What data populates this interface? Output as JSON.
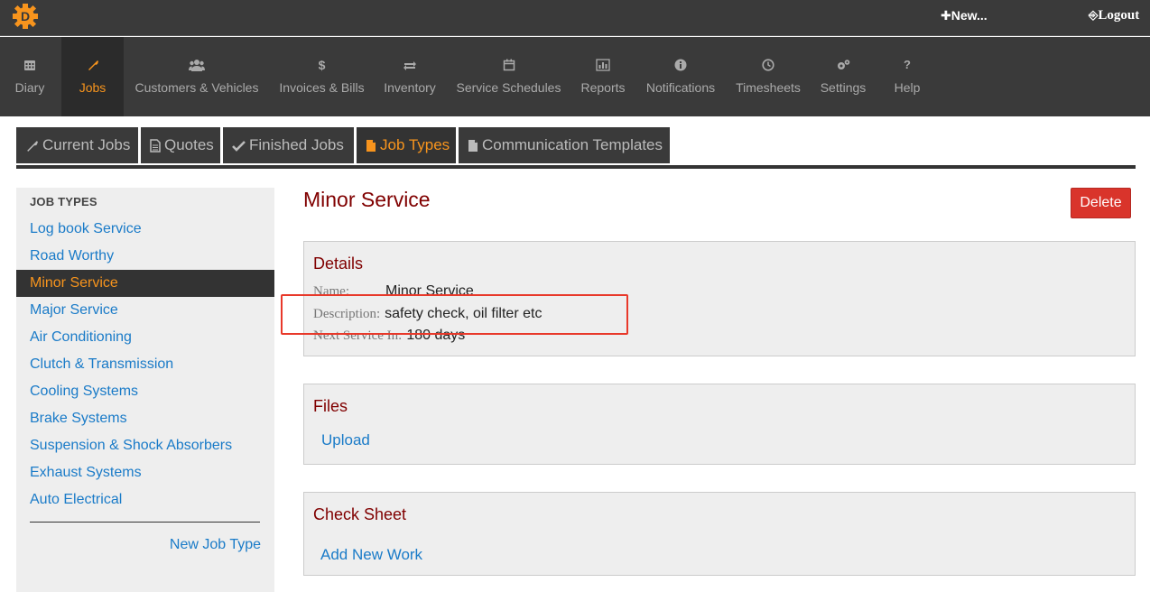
{
  "topbar": {
    "new_label": "New...",
    "logout_label": "Logout",
    "brand_color": "#f7941d"
  },
  "nav": [
    {
      "label": "Diary",
      "icon": "calendar-grid-icon",
      "active": false
    },
    {
      "label": "Jobs",
      "icon": "wrench-icon",
      "active": true
    },
    {
      "label": "Customers & Vehicles",
      "icon": "users-icon",
      "active": false
    },
    {
      "label": "Invoices & Bills",
      "icon": "dollar-icon",
      "active": false
    },
    {
      "label": "Inventory",
      "icon": "exchange-icon",
      "active": false
    },
    {
      "label": "Service Schedules",
      "icon": "calendar-icon",
      "active": false
    },
    {
      "label": "Reports",
      "icon": "bar-chart-icon",
      "active": false
    },
    {
      "label": "Notifications",
      "icon": "info-icon",
      "active": false
    },
    {
      "label": "Timesheets",
      "icon": "clock-icon",
      "active": false
    },
    {
      "label": "Settings",
      "icon": "gears-icon",
      "active": false
    },
    {
      "label": "Help",
      "icon": "question-icon",
      "active": false
    }
  ],
  "tabs": [
    {
      "label": "Current Jobs",
      "icon": "wrench-icon",
      "active": false
    },
    {
      "label": "Quotes",
      "icon": "document-icon",
      "active": false
    },
    {
      "label": "Finished Jobs",
      "icon": "check-icon",
      "active": false
    },
    {
      "label": "Job Types",
      "icon": "file-icon",
      "active": true
    },
    {
      "label": "Communication Templates",
      "icon": "file-icon",
      "active": false
    }
  ],
  "sidebar": {
    "header": "JOB TYPES",
    "items": [
      {
        "label": "Log book Service",
        "active": false
      },
      {
        "label": "Road Worthy",
        "active": false
      },
      {
        "label": "Minor Service",
        "active": true
      },
      {
        "label": "Major Service",
        "active": false
      },
      {
        "label": "Air Conditioning",
        "active": false
      },
      {
        "label": "Clutch & Transmission",
        "active": false
      },
      {
        "label": "Cooling Systems",
        "active": false
      },
      {
        "label": "Brake Systems",
        "active": false
      },
      {
        "label": "Suspension & Shock Absorbers",
        "active": false
      },
      {
        "label": "Exhaust Systems",
        "active": false
      },
      {
        "label": "Auto Electrical",
        "active": false
      }
    ],
    "new_label": "New Job Type"
  },
  "main": {
    "title": "Minor Service",
    "delete_label": "Delete",
    "details": {
      "title": "Details",
      "name_key": "Name:",
      "name_value": "Minor Service",
      "description_key": "Description:",
      "description_value": "safety check, oil filter etc",
      "next_service_key": "Next Service In:",
      "next_service_value": "180 days"
    },
    "files": {
      "title": "Files",
      "upload_label": "Upload"
    },
    "check_sheet": {
      "title": "Check Sheet",
      "add_label": "Add New Work"
    }
  }
}
